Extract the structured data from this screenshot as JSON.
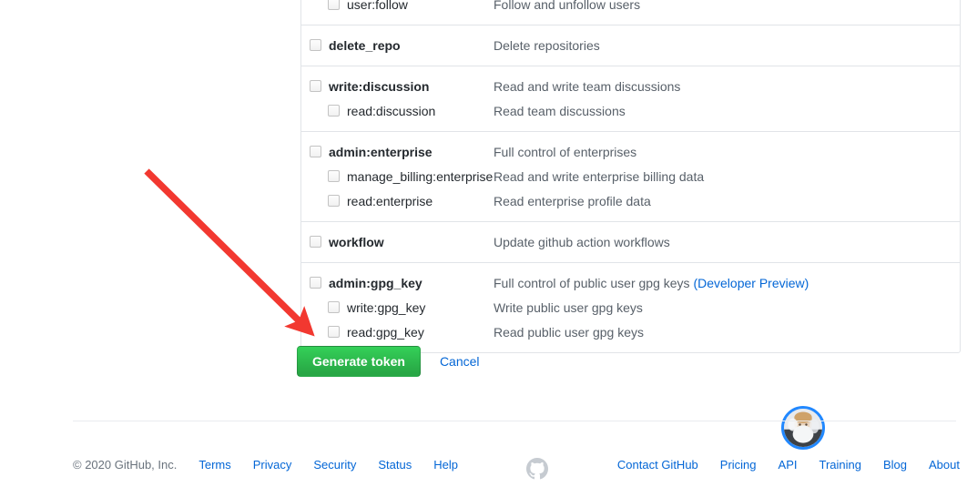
{
  "scopes": {
    "partial_top_row": {
      "name": "",
      "description": ""
    },
    "groups": [
      {
        "rows": [
          {
            "level": 1,
            "name": "user:follow",
            "description": "Follow and unfollow users",
            "checked": false
          }
        ]
      },
      {
        "rows": [
          {
            "level": 0,
            "name": "delete_repo",
            "description": "Delete repositories",
            "checked": false
          }
        ]
      },
      {
        "rows": [
          {
            "level": 0,
            "name": "write:discussion",
            "description": "Read and write team discussions",
            "checked": false
          },
          {
            "level": 1,
            "name": "read:discussion",
            "description": "Read team discussions",
            "checked": false
          }
        ]
      },
      {
        "rows": [
          {
            "level": 0,
            "name": "admin:enterprise",
            "description": "Full control of enterprises",
            "checked": false
          },
          {
            "level": 1,
            "name": "manage_billing:enterprise",
            "description": "Read and write enterprise billing data",
            "checked": false
          },
          {
            "level": 1,
            "name": "read:enterprise",
            "description": "Read enterprise profile data",
            "checked": false
          }
        ]
      },
      {
        "rows": [
          {
            "level": 0,
            "name": "workflow",
            "description": "Update github action workflows",
            "checked": false
          }
        ]
      },
      {
        "rows": [
          {
            "level": 0,
            "name": "admin:gpg_key",
            "description": "Full control of public user gpg keys ",
            "description_link": "(Developer Preview)",
            "checked": false
          },
          {
            "level": 1,
            "name": "write:gpg_key",
            "description": "Write public user gpg keys",
            "checked": false
          },
          {
            "level": 1,
            "name": "read:gpg_key",
            "description": "Read public user gpg keys",
            "checked": false
          }
        ]
      }
    ]
  },
  "actions": {
    "generate_label": "Generate token",
    "cancel_label": "Cancel"
  },
  "annotation": {
    "arrow_color": "#f23830"
  },
  "avatar": {
    "ring_color": "#2188ff"
  },
  "footer": {
    "copyright": "© 2020 GitHub, Inc.",
    "left_links": [
      "Terms",
      "Privacy",
      "Security",
      "Status",
      "Help"
    ],
    "right_links": [
      "Contact GitHub",
      "Pricing",
      "API",
      "Training",
      "Blog",
      "About"
    ],
    "logo_icon": "github-mark-icon"
  },
  "colors": {
    "accent_green": "#28a745",
    "link_blue": "#0366d6",
    "border": "#e1e4e8",
    "muted_text": "#586069"
  }
}
